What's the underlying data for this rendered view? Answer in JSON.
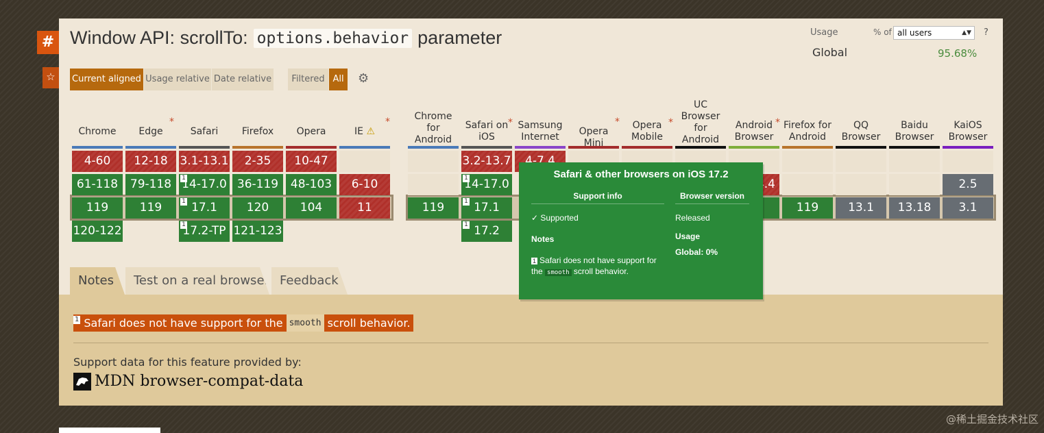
{
  "feature": {
    "title_prefix": "Window API: scrollTo:",
    "title_code": "options.behavior",
    "title_suffix": "parameter",
    "hash_icon": "#",
    "star_icon": "☆"
  },
  "usage": {
    "label": "Usage",
    "pct_of": "% of",
    "users_select": "all users",
    "help": "?",
    "global_label": "Global",
    "global_value": "95.68%"
  },
  "toolbar": {
    "current_aligned": "Current aligned",
    "usage_relative": "Usage relative",
    "date_relative": "Date relative",
    "filtered": "Filtered",
    "all": "All",
    "settings_icon": "⚙"
  },
  "browsers": {
    "chrome": "Chrome",
    "edge": "Edge",
    "safari": "Safari",
    "firefox": "Firefox",
    "opera": "Opera",
    "ie": "IE",
    "chrome_android": "Chrome for Android",
    "safari_ios": "Safari on iOS",
    "samsung": "Samsung Internet",
    "opera_mini": "Opera Mini",
    "opera_mobile": "Opera Mobile",
    "uc": "UC Browser for Android",
    "android": "Android Browser",
    "firefox_android": "Firefox for Android",
    "qq": "QQ Browser",
    "baidu": "Baidu Browser",
    "kaios": "KaiOS Browser",
    "asterisk": "*",
    "warn_icon": "⚠"
  },
  "cells": {
    "chrome": [
      "4-60",
      "61-118",
      "119",
      "120-122"
    ],
    "edge": [
      "12-18",
      "79-118",
      "119"
    ],
    "safari": [
      "3.1-13.1",
      "14-17.0",
      "17.1",
      "17.2-TP"
    ],
    "firefox": [
      "2-35",
      "36-119",
      "120",
      "121-123"
    ],
    "opera": [
      "10-47",
      "48-103",
      "104"
    ],
    "ie": [
      "6-10",
      "11"
    ],
    "chrome_android": [
      "119"
    ],
    "safari_ios": [
      "3.2-13.7",
      "14-17.0",
      "17.1",
      "17.2"
    ],
    "samsung": [
      "4-7.4"
    ],
    "android": [
      "4.4"
    ],
    "firefox_android": [
      "119"
    ],
    "qq": [
      "13.1"
    ],
    "baidu": [
      "13.18"
    ],
    "kaios": [
      "2.5",
      "3.1"
    ],
    "note_marker": "1"
  },
  "tabs": {
    "notes": "Notes",
    "test": "Test on a real browser",
    "feedback": "Feedback"
  },
  "notes": {
    "marker": "1",
    "text_before": "Safari does not have support for the",
    "code": "smooth",
    "text_after": "scroll behavior.",
    "provided_by": "Support data for this feature provided by:",
    "mdn": "MDN browser-compat-data"
  },
  "tooltip": {
    "title": "Safari & other browsers on iOS 17.2",
    "support_info": "Support info",
    "browser_version": "Browser version",
    "supported": "✓ Supported",
    "released": "Released",
    "notes_heading": "Notes",
    "usage_heading": "Usage",
    "global_usage": "Global: 0%",
    "note_marker": "1",
    "note_before": "Safari does not have support for the",
    "note_code": "smooth",
    "note_after": "scroll behavior."
  },
  "watermark": "@稀土掘金技术社区",
  "colors": {
    "supported": "#2e8035",
    "unsupported": "#b0302a",
    "unknown": "#676d73",
    "accent": "#b6690e",
    "note_highlight": "#c9500c",
    "tooltip": "#2a8a39"
  }
}
